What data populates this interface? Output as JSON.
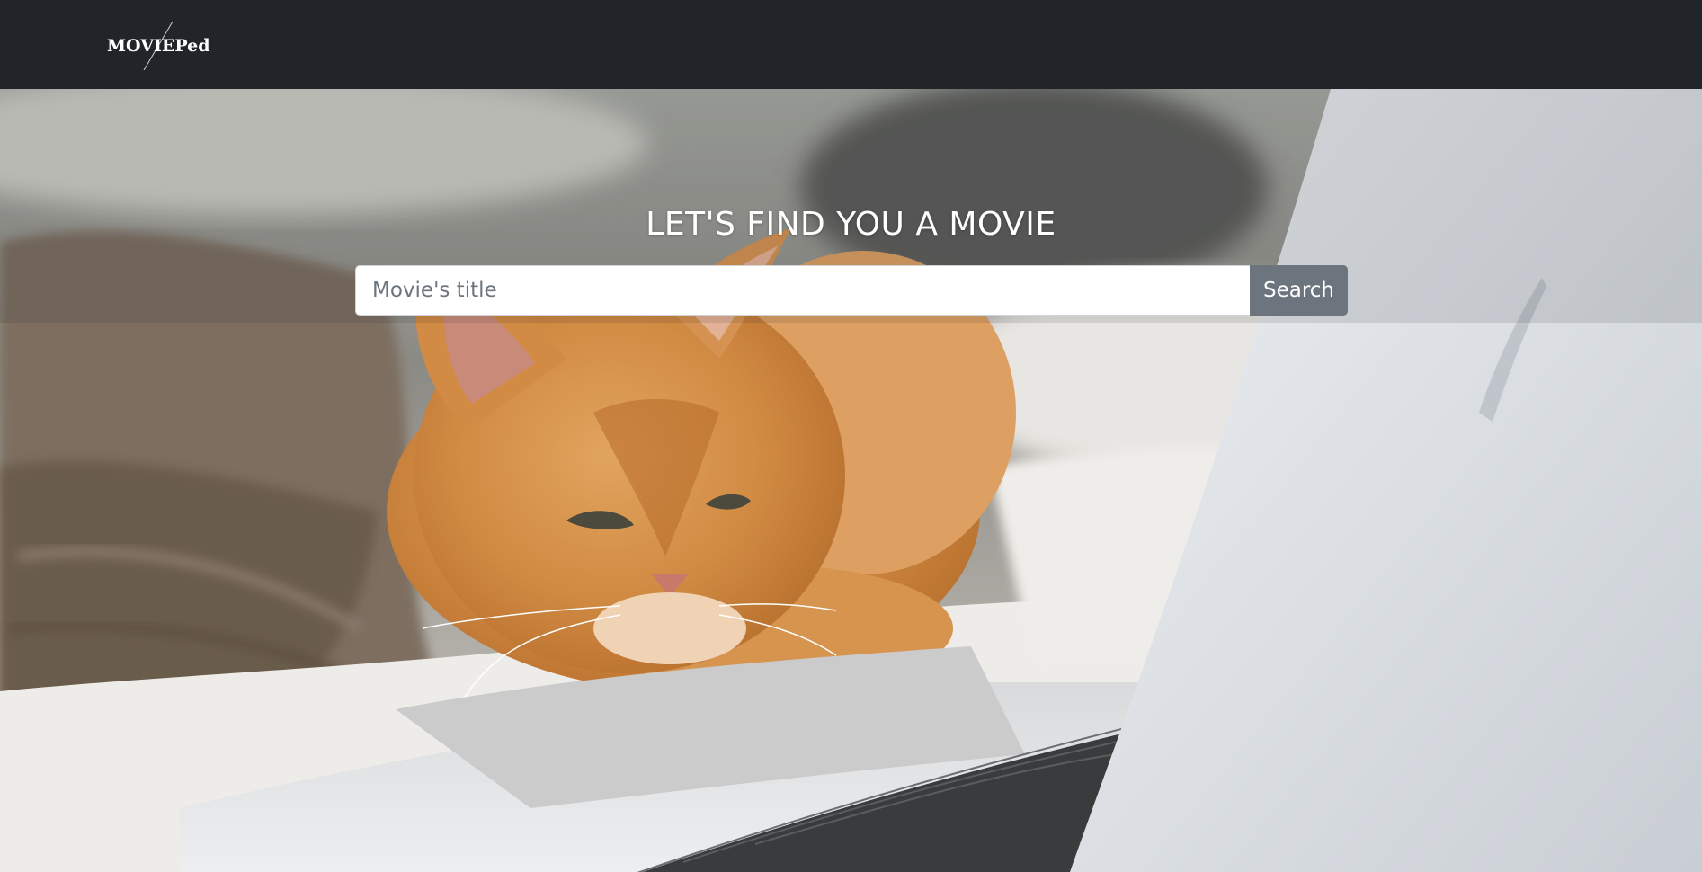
{
  "navbar": {
    "brand": "MOVIEPedia",
    "background": "#212529"
  },
  "hero": {
    "title": "LET'S FIND YOU A MOVIE",
    "background_image": "orange cat lying next to an open laptop on a bed"
  },
  "search": {
    "placeholder": "Movie's title",
    "value": "",
    "button_label": "Search",
    "button_color": "#6c757d"
  }
}
